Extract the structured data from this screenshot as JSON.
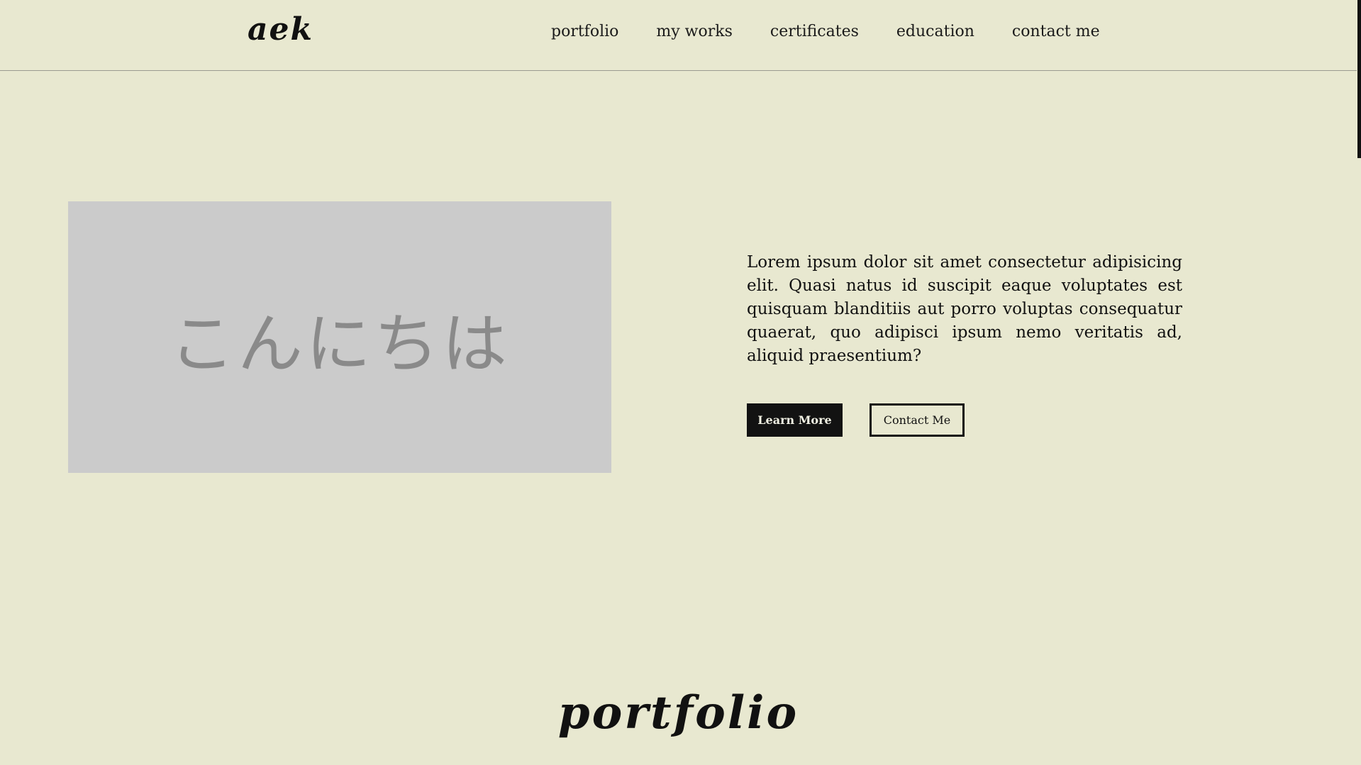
{
  "header": {
    "logo": "aek",
    "nav": [
      {
        "label": "portfolio"
      },
      {
        "label": "my works"
      },
      {
        "label": "certificates"
      },
      {
        "label": "education"
      },
      {
        "label": "contact me"
      }
    ]
  },
  "hero": {
    "image_text": "こんにちは",
    "paragraph": "Lorem ipsum dolor sit amet consectetur adipisicing elit. Quasi natus id suscipit eaque voluptates est quisquam blanditiis aut porro voluptas consequatur quaerat, quo adipisci ipsum nemo veritatis ad, aliquid praesentium?",
    "primary_button": "Learn More",
    "secondary_button": "Contact Me"
  },
  "sections": {
    "portfolio_title": "portfolio"
  },
  "colors": {
    "background": "#e8e8d0",
    "text": "#111111",
    "image_placeholder": "#cbcbcb",
    "image_text": "#8a8a8a",
    "button_dark": "#121212"
  }
}
